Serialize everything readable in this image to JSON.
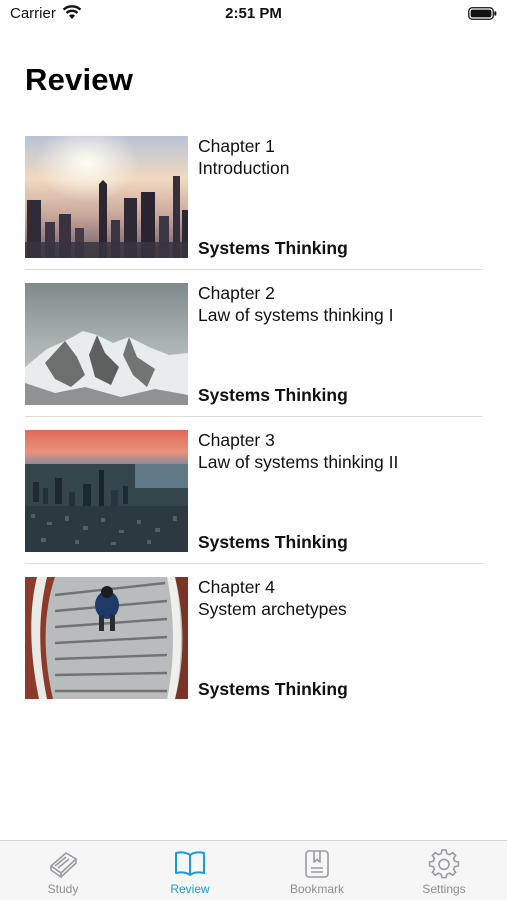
{
  "status_bar": {
    "carrier": "Carrier",
    "time": "2:51 PM"
  },
  "page": {
    "title": "Review"
  },
  "items": [
    {
      "chapter": "Chapter 1",
      "subtitle": "Introduction",
      "book": "Systems Thinking",
      "image": "city-sunrise-skyline"
    },
    {
      "chapter": "Chapter 2",
      "subtitle": "Law of systems thinking I",
      "book": "Systems Thinking",
      "image": "snowy-mountain"
    },
    {
      "chapter": "Chapter 3",
      "subtitle": "Law of systems thinking II",
      "book": "Systems Thinking",
      "image": "aerial-city-sunset"
    },
    {
      "chapter": "Chapter 4",
      "subtitle": "System archetypes",
      "book": "Systems Thinking",
      "image": "spiral-staircase"
    }
  ],
  "tab_bar": {
    "active": "review",
    "accent_color": "#1a9ad6",
    "inactive_color": "#8e8e93",
    "tabs": [
      {
        "id": "study",
        "label": "Study",
        "icon": "book-icon"
      },
      {
        "id": "review",
        "label": "Review",
        "icon": "open-book-icon"
      },
      {
        "id": "bookmark",
        "label": "Bookmark",
        "icon": "bookmark-icon"
      },
      {
        "id": "settings",
        "label": "Settings",
        "icon": "gear-icon"
      }
    ]
  }
}
